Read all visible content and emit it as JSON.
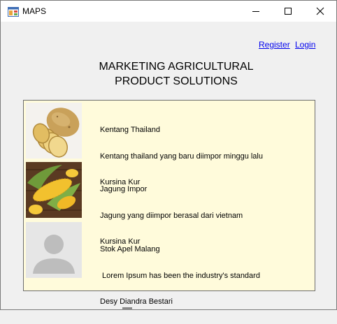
{
  "window": {
    "title": "MAPS",
    "controls": {
      "minimize": "minimize-icon",
      "maximize": "maximize-icon",
      "close": "close-icon"
    }
  },
  "header": {
    "links": {
      "register": "Register",
      "login": "Login"
    },
    "title_line1": "MARKETING AGRICULTURAL",
    "title_line2": "PRODUCT SOLUTIONS"
  },
  "products": [
    {
      "name": "Kentang Thailand",
      "description": "Kentang thailand yang baru diimpor minggu lalu",
      "seller": "Kursina Kur",
      "image": "potato-image"
    },
    {
      "name": "Jagung Impor",
      "description": "Jagung yang diimpor berasal dari vietnam",
      "seller": "Kursina Kur",
      "image": "corn-image"
    },
    {
      "name": "Stok Apel Malang",
      "description": " Lorem Ipsum has been the industry's standard",
      "seller": "Desy Diandra Bestari",
      "image": "user-placeholder-icon"
    }
  ],
  "colors": {
    "window_bg": "#f0f0f0",
    "panel_bg": "#fffbdb",
    "link": "#0000ee"
  }
}
